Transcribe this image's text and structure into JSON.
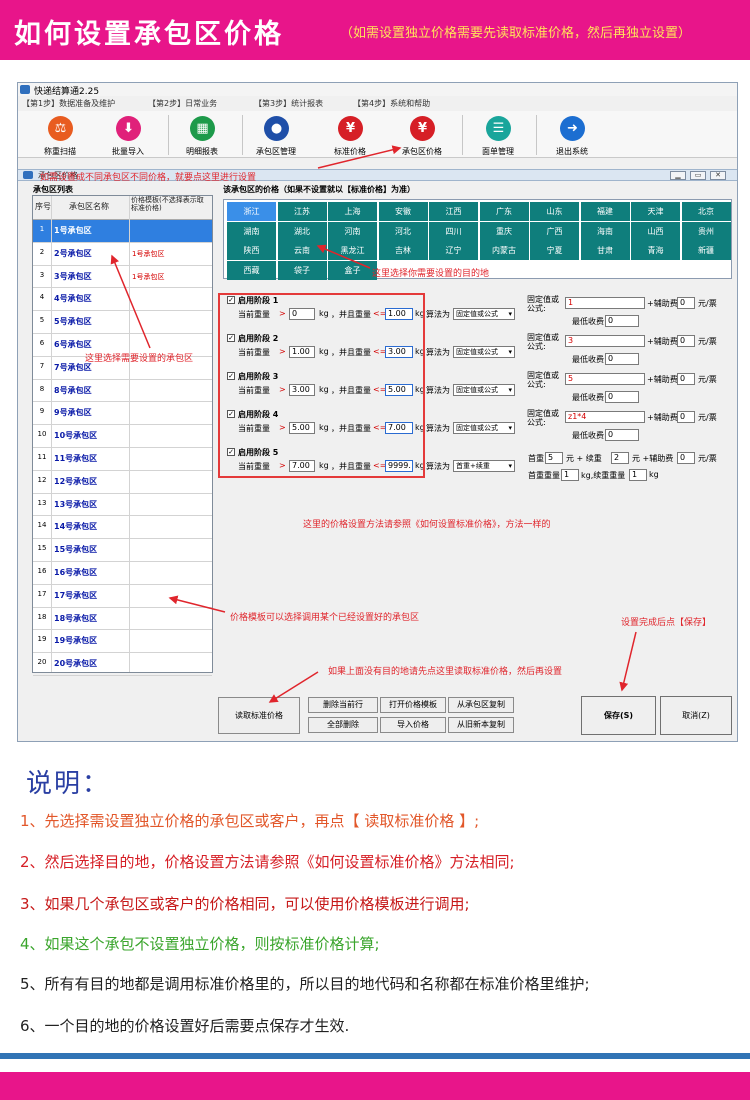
{
  "banner": {
    "title": "如何设置承包区价格",
    "subtitle": "（如需设置独立价格需要先读取标准价格，然后再独立设置）"
  },
  "app": {
    "title": "快递结算通2.25",
    "menu": [
      "【第1步】数据准备及维护",
      "【第2步】日常业务",
      "【第3步】统计报表",
      "【第4步】系统和帮助"
    ],
    "toolbar": [
      {
        "label": "称重扫描",
        "icon": "scale-icon",
        "color": "#e85c20"
      },
      {
        "label": "批量导入",
        "icon": "download-icon",
        "color": "#e0217a"
      },
      {
        "label": "明细报表",
        "icon": "grid-icon",
        "color": "#1d9a4a"
      },
      {
        "label": "承包区管理",
        "icon": "user-icon",
        "color": "#1f4fa8"
      },
      {
        "label": "标准价格",
        "icon": "yen-icon",
        "color": "#d61f26"
      },
      {
        "label": "承包区价格",
        "icon": "user-yen-icon",
        "color": "#d61f26"
      },
      {
        "label": "面单管理",
        "icon": "list-icon",
        "color": "#1aa59b"
      },
      {
        "label": "退出系统",
        "icon": "exit-icon",
        "color": "#1c6ed1"
      }
    ],
    "child_title": "承包区价格",
    "list": {
      "heading": "承包区列表",
      "col_no": "序号",
      "col_name": "承包区名称",
      "col_tpl": "价格模板(不选择表示取标准价格)",
      "rows": [
        {
          "no": "1",
          "name": "1号承包区",
          "tpl": ""
        },
        {
          "no": "2",
          "name": "2号承包区",
          "tpl": "1号承包区"
        },
        {
          "no": "3",
          "name": "3号承包区",
          "tpl": "1号承包区"
        },
        {
          "no": "4",
          "name": "4号承包区",
          "tpl": ""
        },
        {
          "no": "5",
          "name": "5号承包区",
          "tpl": ""
        },
        {
          "no": "6",
          "name": "6号承包区",
          "tpl": ""
        },
        {
          "no": "7",
          "name": "7号承包区",
          "tpl": ""
        },
        {
          "no": "8",
          "name": "8号承包区",
          "tpl": ""
        },
        {
          "no": "9",
          "name": "9号承包区",
          "tpl": ""
        },
        {
          "no": "10",
          "name": "10号承包区",
          "tpl": ""
        },
        {
          "no": "11",
          "name": "11号承包区",
          "tpl": ""
        },
        {
          "no": "12",
          "name": "12号承包区",
          "tpl": ""
        },
        {
          "no": "13",
          "name": "13号承包区",
          "tpl": ""
        },
        {
          "no": "14",
          "name": "14号承包区",
          "tpl": ""
        },
        {
          "no": "15",
          "name": "15号承包区",
          "tpl": ""
        },
        {
          "no": "16",
          "name": "16号承包区",
          "tpl": ""
        },
        {
          "no": "17",
          "name": "17号承包区",
          "tpl": ""
        },
        {
          "no": "18",
          "name": "18号承包区",
          "tpl": ""
        },
        {
          "no": "19",
          "name": "19号承包区",
          "tpl": ""
        },
        {
          "no": "20",
          "name": "20号承包区",
          "tpl": ""
        }
      ]
    },
    "dest": {
      "heading": "该承包区的价格（如果不设置就以【标准价格】为准）",
      "cells": [
        "浙江",
        "江苏",
        "上海",
        "安徽",
        "江西",
        "广东",
        "山东",
        "福建",
        "天津",
        "北京",
        "湖南",
        "湖北",
        "河南",
        "河北",
        "四川",
        "重庆",
        "广西",
        "海南",
        "山西",
        "贵州",
        "陕西",
        "云南",
        "黑龙江",
        "吉林",
        "辽宁",
        "内蒙古",
        "宁夏",
        "甘肃",
        "青海",
        "新疆",
        "西藏",
        "袋子",
        "盒子"
      ]
    },
    "stages": [
      {
        "label": "启用阶段 1",
        "cur": "当前重量",
        "w_from": "0",
        "w_to": "1.00",
        "unit": "kg",
        "and": "，并且重量",
        "algo_lbl": "算法为",
        "algo": "固定值或公式",
        "fixed_lbl": "固定值或公式:",
        "fixed": "1",
        "aux_lbl": "+辅助费",
        "aux": "0",
        "aux_unit": "元/票",
        "min_lbl": "最低收费",
        "min": "0"
      },
      {
        "label": "启用阶段 2",
        "cur": "当前重量",
        "w_from": "1.00",
        "w_to": "3.00",
        "unit": "kg",
        "and": "，并且重量",
        "algo_lbl": "算法为",
        "algo": "固定值或公式",
        "fixed_lbl": "固定值或公式:",
        "fixed": "3",
        "aux_lbl": "+辅助费",
        "aux": "0",
        "aux_unit": "元/票",
        "min_lbl": "最低收费",
        "min": "0"
      },
      {
        "label": "启用阶段 3",
        "cur": "当前重量",
        "w_from": "3.00",
        "w_to": "5.00",
        "unit": "kg",
        "and": "，并且重量",
        "algo_lbl": "算法为",
        "algo": "固定值或公式",
        "fixed_lbl": "固定值或公式:",
        "fixed": "5",
        "aux_lbl": "+辅助费",
        "aux": "0",
        "aux_unit": "元/票",
        "min_lbl": "最低收费",
        "min": "0"
      },
      {
        "label": "启用阶段 4",
        "cur": "当前重量",
        "w_from": "5.00",
        "w_to": "7.00",
        "unit": "kg",
        "and": "，并且重量",
        "algo_lbl": "算法为",
        "algo": "固定值或公式",
        "fixed_lbl": "固定值或公式:",
        "fixed": "z1*4",
        "aux_lbl": "+辅助费",
        "aux": "0",
        "aux_unit": "元/票",
        "min_lbl": "最低收费",
        "min": "0"
      }
    ],
    "stage5": {
      "label": "启用阶段 5",
      "cur": "当前重量",
      "w_from": "7.00",
      "w_to": "9999.",
      "unit": "kg",
      "and": "，并且重量",
      "algo_lbl": "算法为",
      "algo": "首重+续重",
      "first_lbl": "首重",
      "first": "5",
      "yuan_add": "元 + 续重",
      "cont": "2",
      "yuan_aux": "元 +辅助费",
      "aux": "0",
      "aux_unit": "元/票",
      "first_w_lbl": "首重重量",
      "first_w": "1",
      "cont_w_lbl": "kg,续重重量",
      "cont_w": "1",
      "cont_w_unit": "kg"
    },
    "gt": ">",
    "le": "<=",
    "buttons": {
      "read_std": "读取标准价格",
      "del_row": "删除当前行",
      "del_all": "全部删除",
      "open_tpl": "打开价格模板",
      "import": "导入价格",
      "copy_area": "从承包区复制",
      "copy_old": "从旧新本复制",
      "save": "保存(S)",
      "cancel": "取消(Z)"
    }
  },
  "annotations": {
    "toolbar": "如需设置成不同承包区不同价格，就要点这里进行设置",
    "dest": "这里选择你需要设置的目的地",
    "list": "这里选择需要设置的承包区",
    "method": "这里的价格设置方法请参照《如何设置标准价格》，方法一样的",
    "template": "价格模板可以选择调用某个已经设置好的承包区",
    "save": "设置完成后点【保存】",
    "read": "如果上面没有目的地请先点这里读取标准价格，然后再设置"
  },
  "notes": {
    "title": "说明：",
    "items": [
      {
        "text": "1、先选择需设置独立价格的承包区或客户，再点【 读取标准价格 】;",
        "color": "#e2572a"
      },
      {
        "text": "2、然后选择目的地，价格设置方法请参照《如何设置标准价格》方法相同;",
        "color": "#d61f26"
      },
      {
        "text": "3、如果几个承包区或客户的价格相同，可以使用价格模板进行调用;",
        "color": "#c61818"
      },
      {
        "text": "4、如果这个承包不设置独立价格，则按标准价格计算;",
        "color": "#3aa52c"
      },
      {
        "text": "5、所有有目的地都是调用标准价格里的，所以目的地代码和名称都在标准价格里维护;",
        "color": "#222222"
      },
      {
        "text": "6、一个目的地的价格设置好后需要点保存才生效.",
        "color": "#222222"
      }
    ]
  },
  "colors": {
    "banner": "#e8158a",
    "accent": "#2f7fe0",
    "teal": "#0f7e7c",
    "annotation": "#e0252c"
  }
}
